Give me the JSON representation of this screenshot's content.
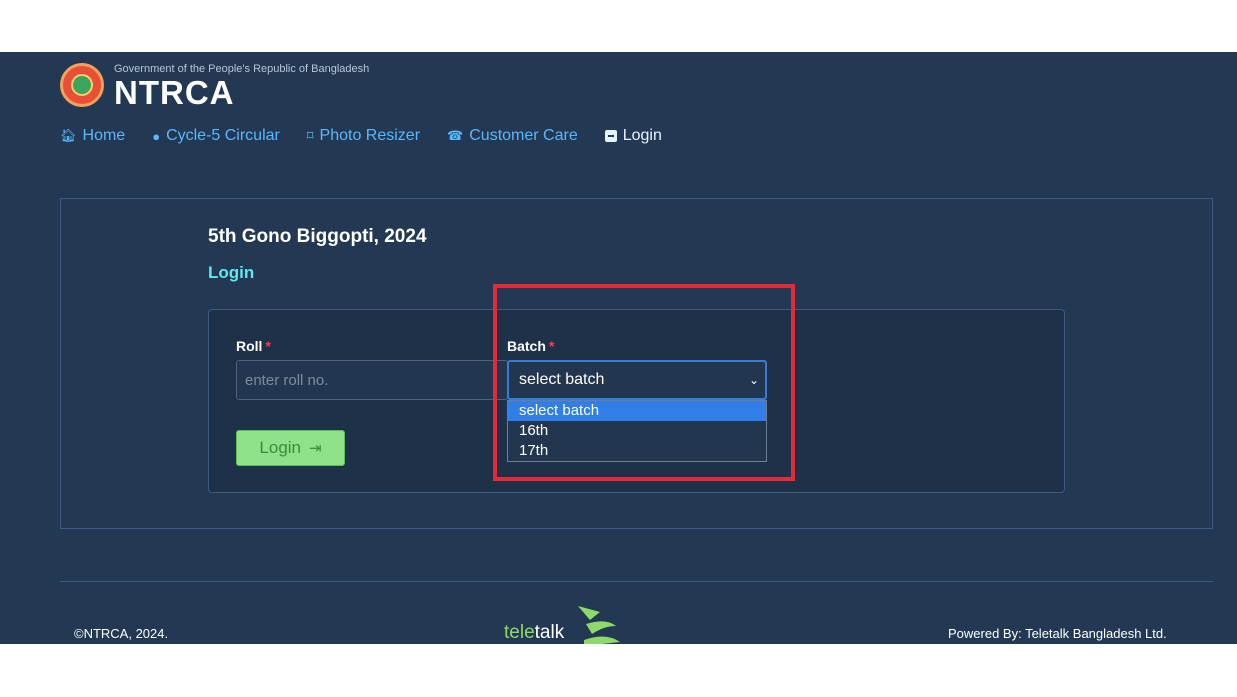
{
  "header": {
    "gov_line": "Government of the People's Republic of Bangladesh",
    "org_name": "NTRCA",
    "logo_icon": "ntrca-emblem-icon"
  },
  "nav": [
    {
      "label": "Home",
      "icon": "home-icon"
    },
    {
      "label": "Cycle-5 Circular",
      "icon": "info-circle-icon"
    },
    {
      "label": "Photo Resizer",
      "icon": "crop-icon"
    },
    {
      "label": "Customer Care",
      "icon": "phone-icon"
    },
    {
      "label": "Login",
      "icon": "login-box-icon"
    }
  ],
  "main": {
    "title": "5th Gono Biggopti, 2024",
    "subtitle": "Login",
    "form": {
      "roll_label": "Roll",
      "roll_placeholder": "enter roll no.",
      "batch_label": "Batch",
      "batch_selected": "select batch",
      "batch_options": [
        "select batch",
        "16th",
        "17th"
      ],
      "required_mark": "*",
      "login_button": "Login"
    }
  },
  "footer": {
    "copyright": "©NTRCA, 2024.",
    "powered_by": "Powered By: Teletalk Bangladesh Ltd.",
    "teletalk_part1": "tele",
    "teletalk_part2": "talk"
  },
  "colors": {
    "background": "#233853",
    "accent_link": "#58b7ff",
    "highlight": "#e12b3a",
    "login_button": "#8ee38a",
    "selected_option": "#2f7fe6"
  }
}
